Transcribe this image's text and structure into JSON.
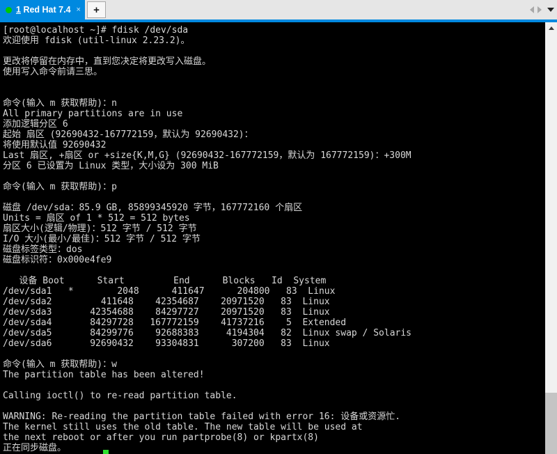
{
  "window": {
    "tab": {
      "index": "1",
      "title": "Red Hat 7.4",
      "full_label": "1 Red Hat 7.4",
      "close_glyph": "×",
      "status_dot_color": "#00c800",
      "active_color": "#0089e0"
    },
    "new_tab_label": "+",
    "nav_prev_icon": "triangle-left-icon",
    "nav_next_icon": "triangle-right-icon",
    "menu_icon": "chevron-down-icon"
  },
  "scrollbar": {
    "up_arrow_icon": "scroll-up-arrow-icon",
    "thumb_color": "#c4c4c4",
    "track_color": "#f1f1f1"
  },
  "terminal": {
    "foreground": "#d8d8d8",
    "background": "#000000",
    "cursor_color": "#2ee02e",
    "lines": [
      "[root@localhost ~]# fdisk /dev/sda",
      "欢迎使用 fdisk (util-linux 2.23.2)。",
      "",
      "更改将停留在内存中，直到您决定将更改写入磁盘。",
      "使用写入命令前请三思。",
      "",
      "",
      "命令(输入 m 获取帮助)：n",
      "All primary partitions are in use",
      "添加逻辑分区 6",
      "起始 扇区 (92690432-167772159，默认为 92690432)：",
      "将使用默认值 92690432",
      "Last 扇区, +扇区 or +size{K,M,G} (92690432-167772159，默认为 167772159)：+300M",
      "分区 6 已设置为 Linux 类型，大小设为 300 MiB",
      "",
      "命令(输入 m 获取帮助)：p",
      "",
      "磁盘 /dev/sda：85.9 GB, 85899345920 字节，167772160 个扇区",
      "Units = 扇区 of 1 * 512 = 512 bytes",
      "扇区大小(逻辑/物理)：512 字节 / 512 字节",
      "I/O 大小(最小/最佳)：512 字节 / 512 字节",
      "磁盘标签类型：dos",
      "磁盘标识符：0x000e4fe9",
      "",
      "   设备 Boot      Start         End      Blocks   Id  System",
      "/dev/sda1   *        2048      411647      204800   83  Linux",
      "/dev/sda2         411648    42354687    20971520   83  Linux",
      "/dev/sda3       42354688    84297727    20971520   83  Linux",
      "/dev/sda4       84297728   167772159    41737216    5  Extended",
      "/dev/sda5       84299776    92688383     4194304   82  Linux swap / Solaris",
      "/dev/sda6       92690432    93304831      307200   83  Linux",
      "",
      "命令(输入 m 获取帮助)：w",
      "The partition table has been altered!",
      "",
      "Calling ioctl() to re-read partition table.",
      "",
      "WARNING: Re-reading the partition table failed with error 16: 设备或资源忙.",
      "The kernel still uses the old table. The new table will be used at",
      "the next reboot or after you run partprobe(8) or kpartx(8)",
      "正在同步磁盘。"
    ]
  }
}
